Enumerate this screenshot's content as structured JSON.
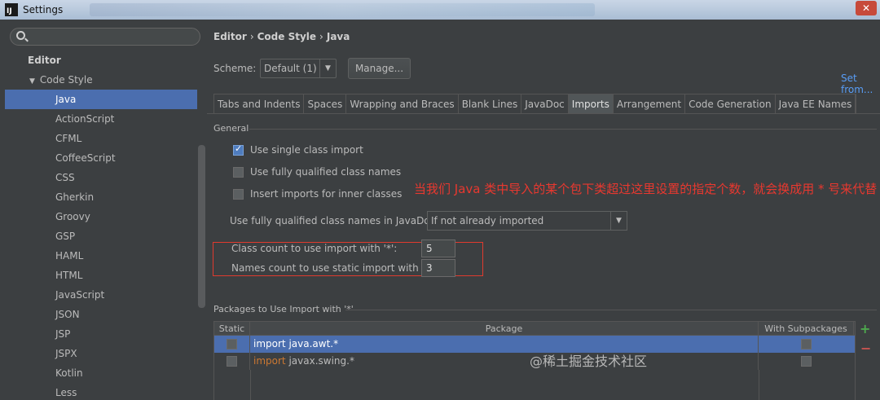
{
  "window": {
    "title": "Settings",
    "app_icon": "IJ",
    "close_glyph": "✕"
  },
  "search": {
    "placeholder": ""
  },
  "sidebar": {
    "items": [
      {
        "label": "Editor",
        "level": 0
      },
      {
        "label": "Code Style",
        "level": 1,
        "expanded": true
      },
      {
        "label": "Java",
        "level": 2,
        "selected": true
      },
      {
        "label": "ActionScript",
        "level": 2
      },
      {
        "label": "CFML",
        "level": 2
      },
      {
        "label": "CoffeeScript",
        "level": 2
      },
      {
        "label": "CSS",
        "level": 2
      },
      {
        "label": "Gherkin",
        "level": 2
      },
      {
        "label": "Groovy",
        "level": 2
      },
      {
        "label": "GSP",
        "level": 2
      },
      {
        "label": "HAML",
        "level": 2
      },
      {
        "label": "HTML",
        "level": 2
      },
      {
        "label": "JavaScript",
        "level": 2
      },
      {
        "label": "JSON",
        "level": 2
      },
      {
        "label": "JSP",
        "level": 2
      },
      {
        "label": "JSPX",
        "level": 2
      },
      {
        "label": "Kotlin",
        "level": 2
      },
      {
        "label": "Less",
        "level": 2
      }
    ]
  },
  "breadcrumb": {
    "part1": "Editor",
    "part2": "Code Style",
    "part3": "Java",
    "sep": "›"
  },
  "scheme": {
    "label": "Scheme:",
    "value": "Default (1)",
    "manage_label": "Manage...",
    "set_from": "Set from..."
  },
  "tabs": [
    {
      "label": "Tabs and Indents"
    },
    {
      "label": "Spaces"
    },
    {
      "label": "Wrapping and Braces"
    },
    {
      "label": "Blank Lines"
    },
    {
      "label": "JavaDoc"
    },
    {
      "label": "Imports",
      "active": true
    },
    {
      "label": "Arrangement"
    },
    {
      "label": "Code Generation"
    },
    {
      "label": "Java EE Names"
    }
  ],
  "general": {
    "title": "General",
    "opt1": {
      "label": "Use single class import",
      "checked": true
    },
    "opt2": {
      "label": "Use fully qualified class names",
      "checked": false
    },
    "opt3": {
      "label": "Insert imports for inner classes",
      "checked": false
    },
    "javadoc_label": "Use fully qualified class names in JavaDoc:",
    "javadoc_value": "If not already imported",
    "class_count_label": "Class count to use import with '*':",
    "class_count_value": "5",
    "names_count_label": "Names count to use static import with '*':",
    "names_count_value": "3"
  },
  "annotation": {
    "text": "当我们 Java 类中导入的某个包下类超过这里设置的指定个数，就会换成用 * 号来代替",
    "color": "#e8382f"
  },
  "packages": {
    "title": "Packages to Use Import with '*'",
    "col_static": "Static",
    "col_package": "Package",
    "col_sub": "With Subpackages",
    "row1": {
      "keyword": "import",
      "name": "java.awt.*",
      "selected": true
    },
    "row2": {
      "keyword": "import",
      "name": "javax.swing.*",
      "selected": false
    },
    "add": "+",
    "remove": "−"
  },
  "watermark": "@稀土掘金技术社区",
  "colors": {
    "selection": "#4b6eaf",
    "link": "#589df6",
    "annotation_box": "#e03a2e"
  }
}
